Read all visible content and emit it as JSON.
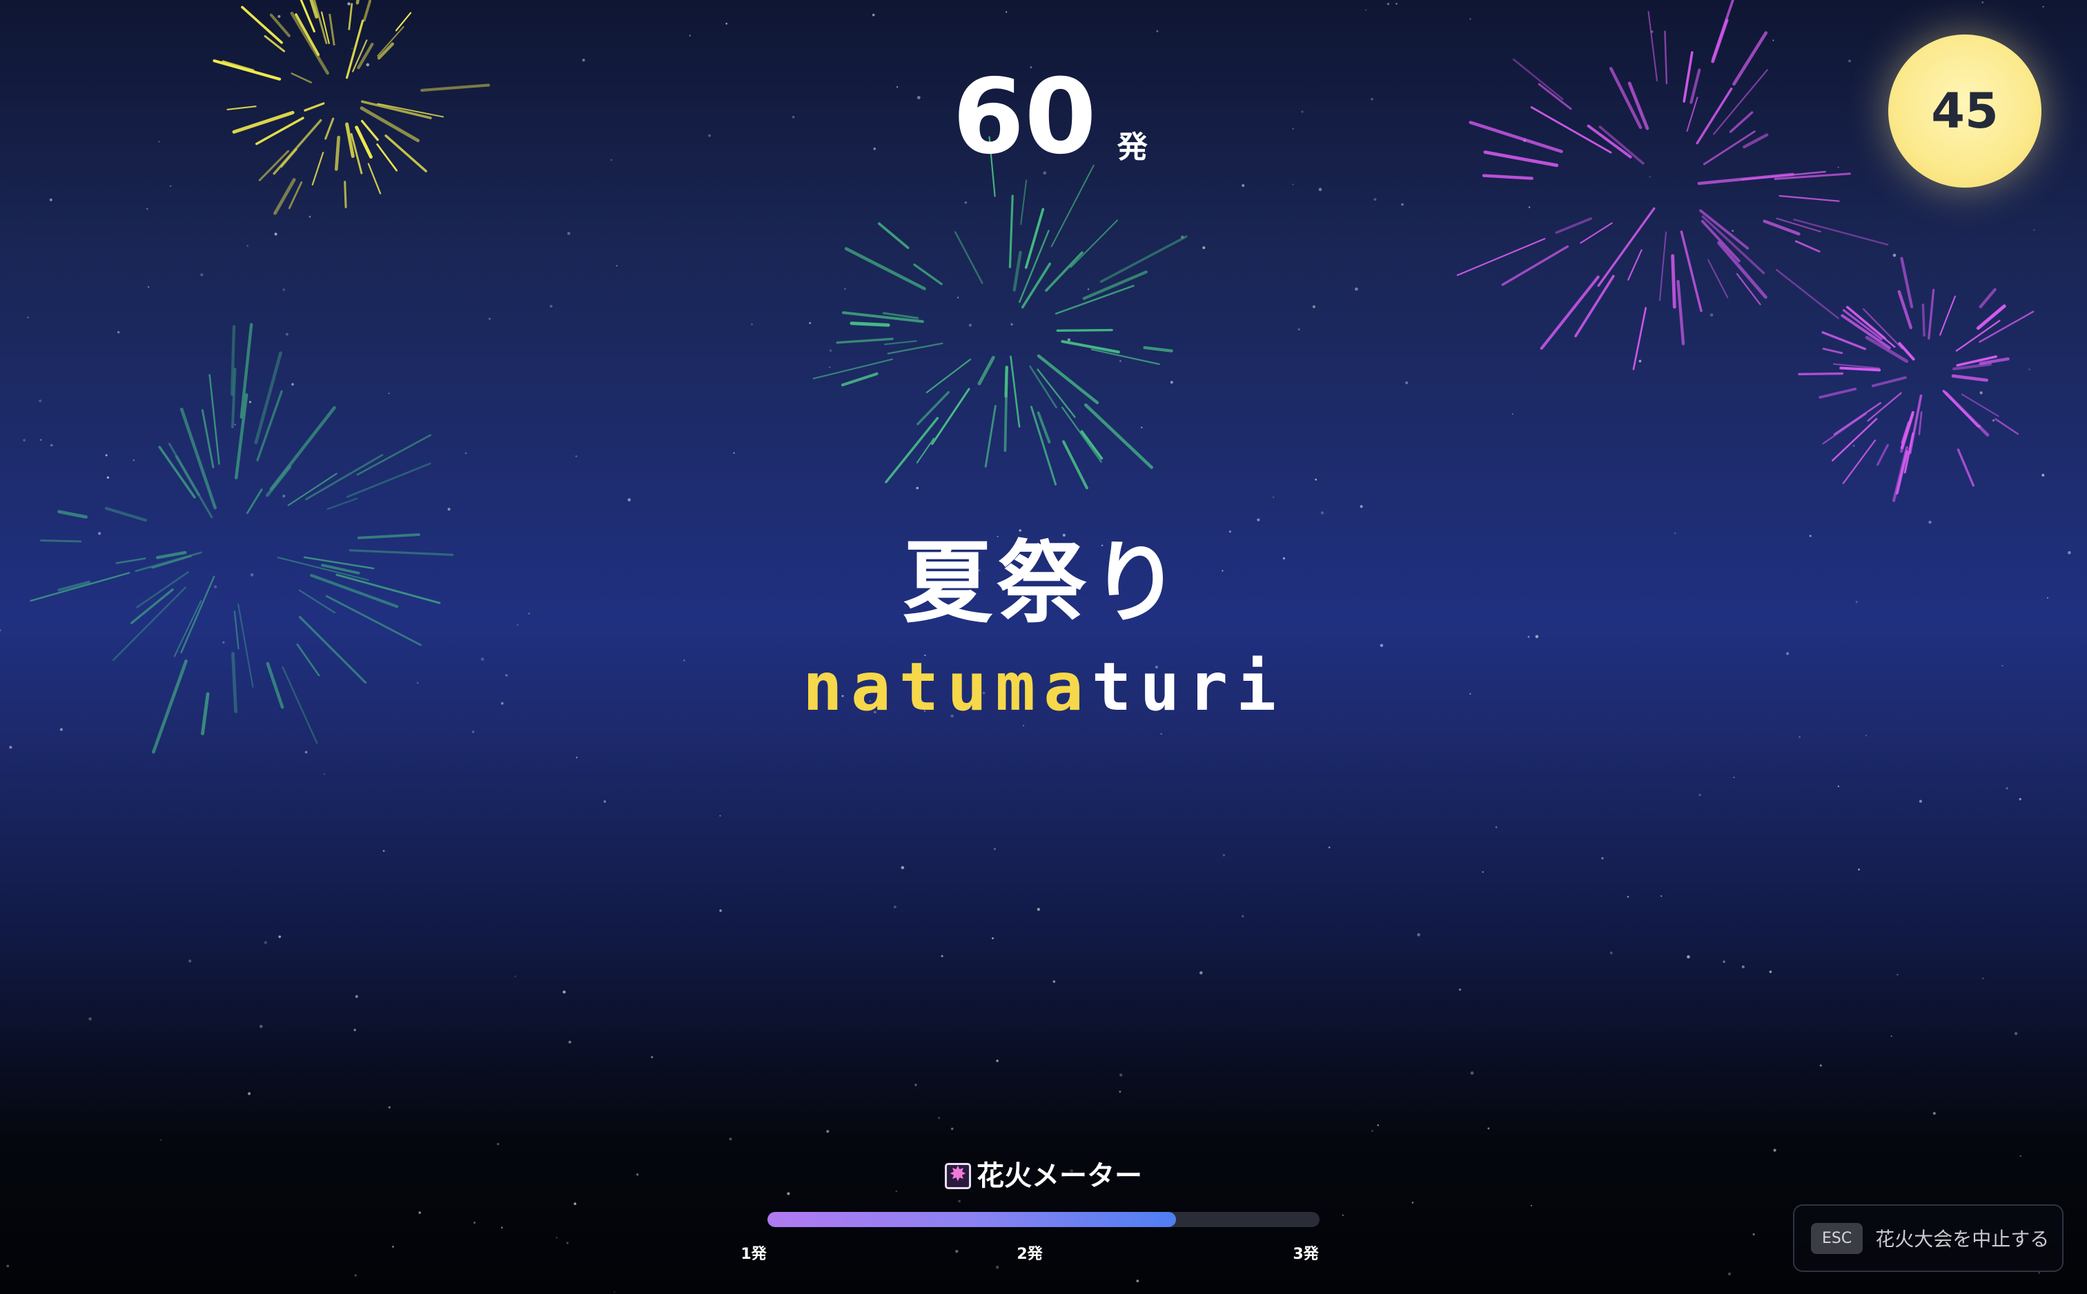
{
  "hud": {
    "shots_count": "60",
    "shots_unit": "発",
    "timer_seconds": "45"
  },
  "prompt": {
    "word": "夏祭り",
    "romaji_typed": "natuma",
    "romaji_remaining": "turi"
  },
  "meter": {
    "label": "花火メーター",
    "icon": "firework-icon",
    "progress_fraction": 0.74,
    "ticks": [
      "1発",
      "2発",
      "3発"
    ]
  },
  "esc": {
    "key_label": "ESC",
    "text": "花火大会を中止する"
  },
  "colors": {
    "typed": "#f6d84a",
    "fireworks": [
      "#f2ec4e",
      "#4fd68b",
      "#d95cf2"
    ]
  }
}
